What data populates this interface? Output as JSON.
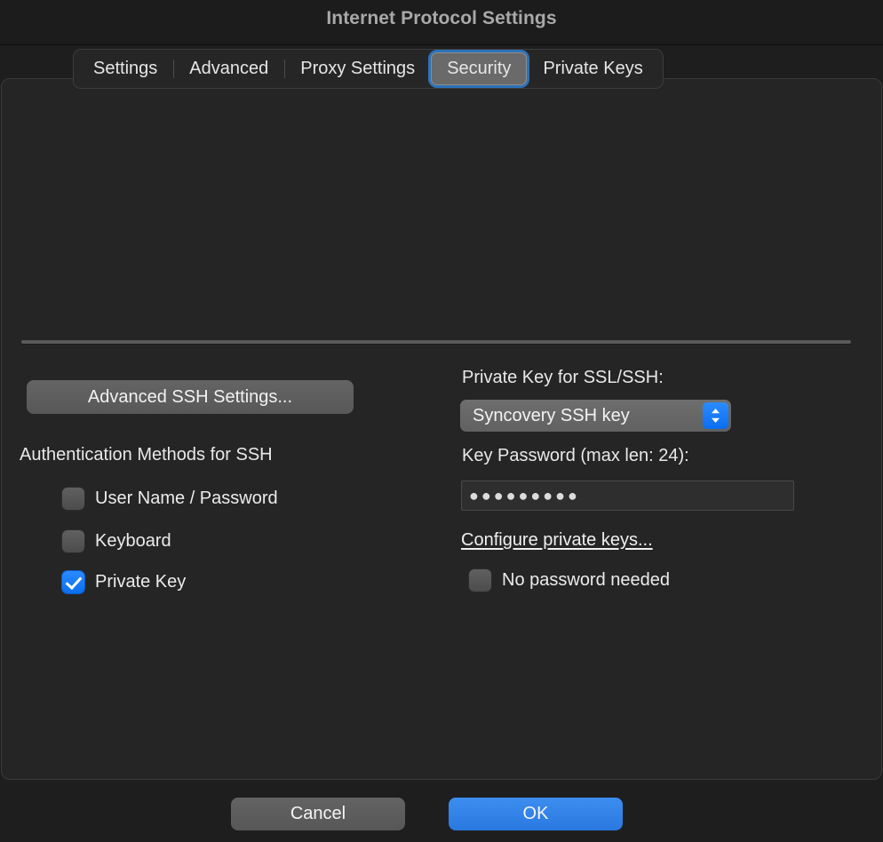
{
  "window": {
    "title": "Internet Protocol Settings"
  },
  "tabs": [
    {
      "label": "Settings",
      "selected": false
    },
    {
      "label": "Advanced",
      "selected": false
    },
    {
      "label": "Proxy Settings",
      "selected": false
    },
    {
      "label": "Security",
      "selected": true
    },
    {
      "label": "Private Keys",
      "selected": false
    }
  ],
  "left_panel": {
    "advanced_ssh_button": "Advanced SSH Settings...",
    "auth_methods_label": "Authentication Methods for SSH",
    "auth_methods": [
      {
        "label": "User Name / Password",
        "checked": false
      },
      {
        "label": "Keyboard",
        "checked": false
      },
      {
        "label": "Private Key",
        "checked": true
      }
    ]
  },
  "right_panel": {
    "private_key_label": "Private Key for SSL/SSH:",
    "private_key_selected": "Syncovery SSH key",
    "stepper_icon": "stepper-updown-icon",
    "key_password_label": "Key Password (max len: 24):",
    "key_password_value": "●●●●●●●●●",
    "configure_keys_link": "Configure private keys...",
    "no_password_needed": {
      "label": "No password needed",
      "checked": false
    }
  },
  "footer": {
    "cancel_label": "Cancel",
    "ok_label": "OK"
  },
  "colors": {
    "window_bg": "#1e1e1e",
    "panel_bg": "#252525",
    "accent_blue": "#2a78e0",
    "focus_ring": "#2d72b8",
    "control_gray": "#5e5e5e",
    "text_primary": "#e8e8e8",
    "title_gray": "#a9a9a9"
  }
}
